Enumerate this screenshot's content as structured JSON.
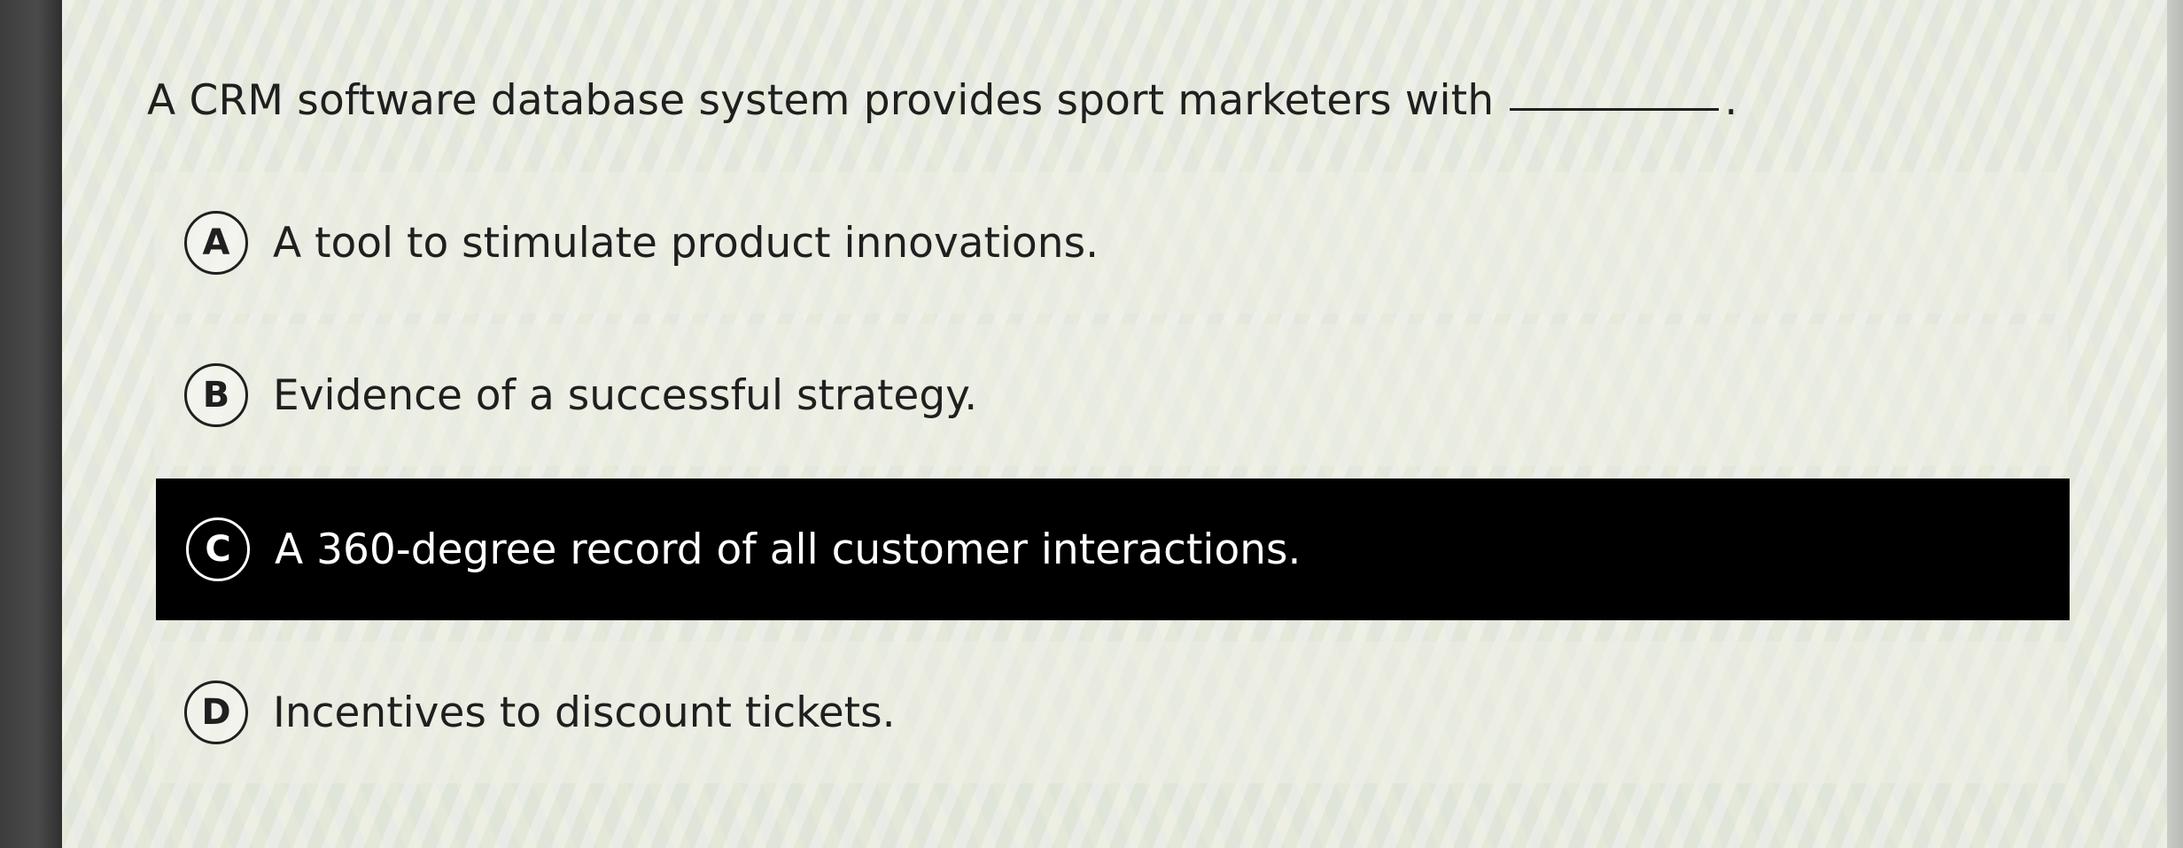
{
  "question": {
    "text": "A CRM software database system provides sport marketers with",
    "terminal": "."
  },
  "options": [
    {
      "letter": "A",
      "text": "A tool to stimulate product innovations.",
      "selected": false
    },
    {
      "letter": "B",
      "text": "Evidence of a successful strategy.",
      "selected": false
    },
    {
      "letter": "C",
      "text": "A 360-degree record of all customer interactions.",
      "selected": true
    },
    {
      "letter": "D",
      "text": "Incentives to discount tickets.",
      "selected": false
    }
  ],
  "colors": {
    "selected_background": "#000000",
    "selected_text": "#ffffff",
    "text": "#1f1f1f"
  }
}
